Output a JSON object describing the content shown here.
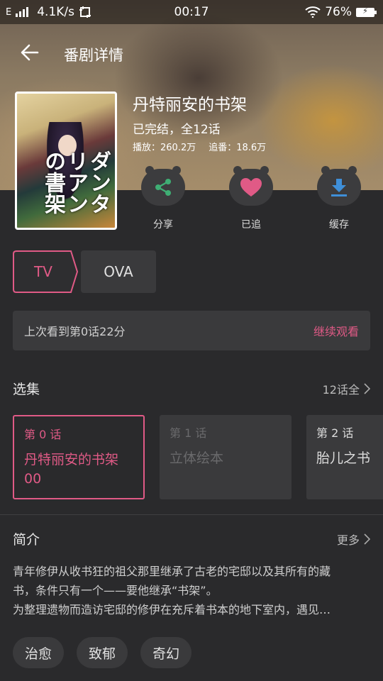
{
  "status_bar": {
    "network_type": "E",
    "speed": "4.1K/s",
    "time": "00:17",
    "battery": "76%"
  },
  "appbar": {
    "title": "番剧详情"
  },
  "show": {
    "cover_title_art": "ダンタリアンの書架",
    "title": "丹特丽安的书架",
    "status": "已完结，全12话",
    "plays": "播放：260.2万",
    "follows": "追番：18.6万"
  },
  "actions": [
    {
      "label": "分享",
      "icon": "share-icon",
      "color": "#3fae74"
    },
    {
      "label": "已追",
      "icon": "heart-icon",
      "color": "#e05a86"
    },
    {
      "label": "缓存",
      "icon": "download-icon",
      "color": "#3f8fd8"
    }
  ],
  "season_tabs": [
    {
      "label": "TV",
      "selected": true
    },
    {
      "label": "OVA",
      "selected": false
    }
  ],
  "resume": {
    "text": "上次看到第0话22分",
    "button": "继续观看"
  },
  "episodes_section": {
    "title": "选集",
    "more": "12话全"
  },
  "episodes": [
    {
      "num": "第 0 话",
      "name": "丹特丽安的书架00",
      "state": "active"
    },
    {
      "num": "第 1 话",
      "name": "立体绘本",
      "state": "dim"
    },
    {
      "num": "第 2 话",
      "name": "胎儿之书",
      "state": "normal"
    }
  ],
  "intro_section": {
    "title": "简介",
    "more": "更多",
    "text_line1": "青年修伊从收书狂的祖父那里继承了古老的宅邸以及其所有的藏",
    "text_line2": "书，条件只有一个——要他继承“书架”。",
    "text_line3": "为整理遗物而造访宅邸的修伊在充斥着书本的地下室内，遇见…"
  },
  "tags": [
    "治愈",
    "致郁",
    "奇幻"
  ],
  "colors": {
    "accent": "#e05a86",
    "background": "#2a2a2c",
    "card": "#3a3a3c"
  }
}
